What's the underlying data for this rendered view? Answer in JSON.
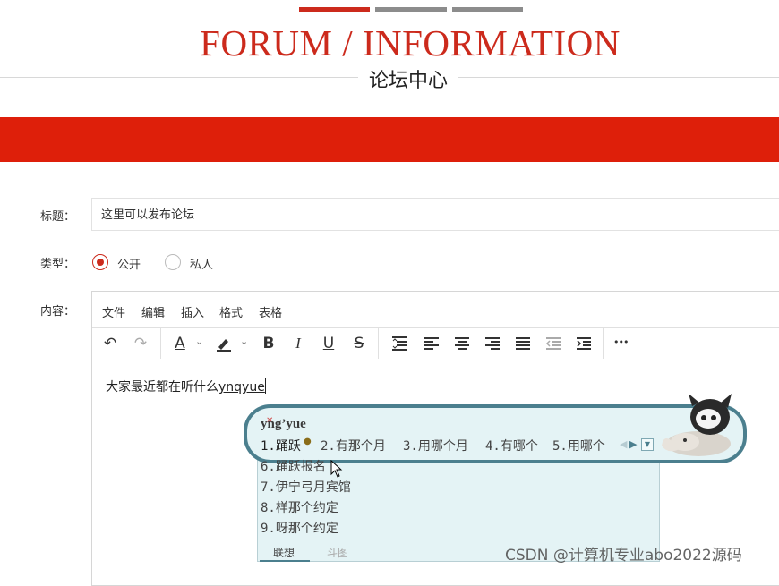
{
  "header": {
    "title_en": "FORUM / INFORMATION",
    "title_cn": "论坛中心"
  },
  "form": {
    "title_label": "标题：",
    "title_value": "这里可以发布论坛",
    "type_label": "类型：",
    "type_options": [
      "公开",
      "私人"
    ],
    "type_selected": "公开",
    "content_label": "内容："
  },
  "editor": {
    "menu": [
      "文件",
      "编辑",
      "插入",
      "格式",
      "表格"
    ],
    "toolbar": {
      "undo": "↶",
      "redo": "↷",
      "font_color": "A",
      "bold": "B",
      "italic": "I",
      "underline": "U",
      "strike": "S",
      "more": "•••"
    },
    "content_text": "大家最近都在听什么",
    "content_pinyin": "ynqyue"
  },
  "ime": {
    "pinyin": "yng’yue",
    "candidates_row": [
      "1.踊跃",
      "2.有那个月",
      "3.用哪个月",
      "4.有哪个",
      "5.用哪个"
    ],
    "candidates_list": [
      "6.踊跃报名",
      "7.伊宁弓月宾馆",
      "8.样那个约定",
      "9.呀那个约定"
    ],
    "tabs": [
      "联想",
      "斗图"
    ],
    "accent_color": "#4b7f8e"
  },
  "colors": {
    "brand_red": "#de1f0a",
    "title_red": "#cc2a1c"
  },
  "watermark": "CSDN @计算机专业abo2022源码"
}
